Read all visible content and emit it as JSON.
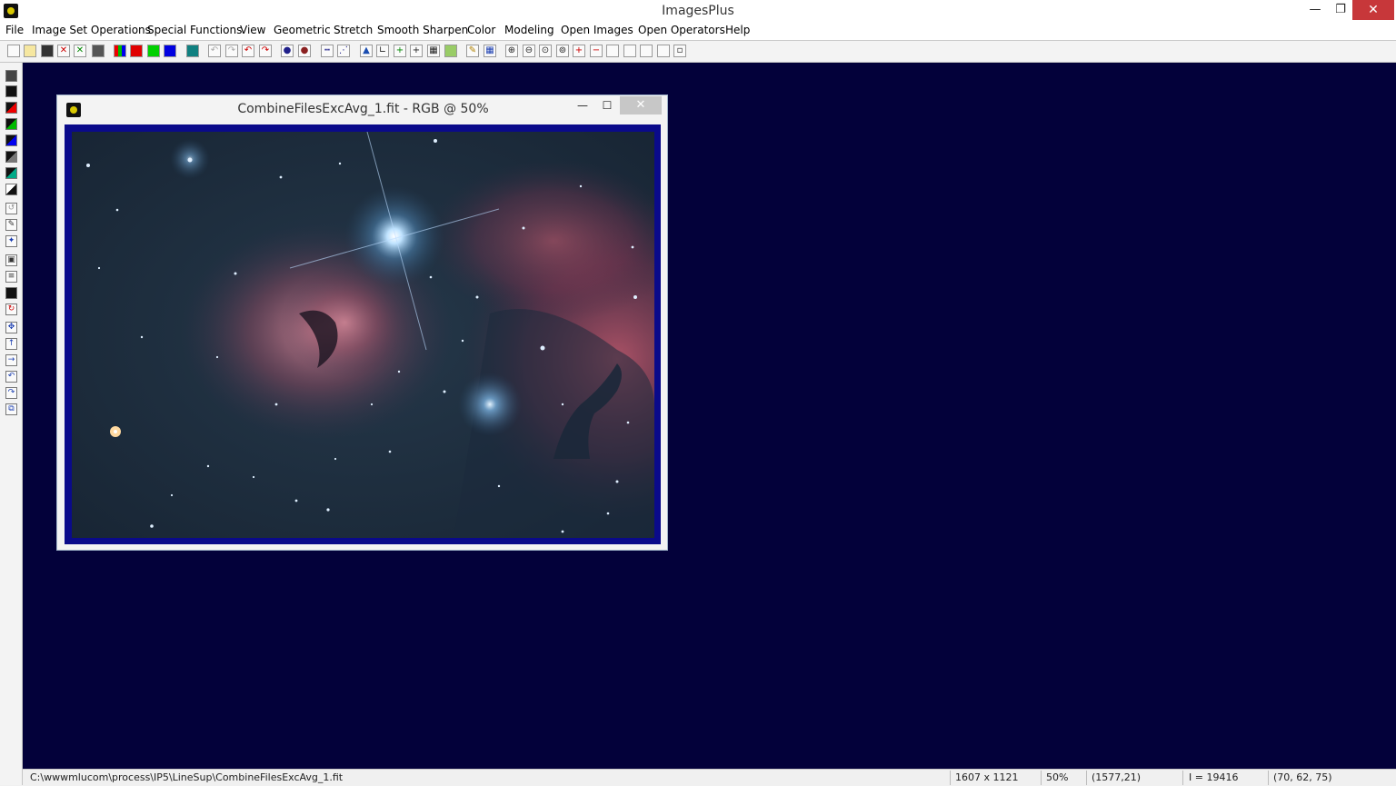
{
  "app": {
    "title": "ImagesPlus"
  },
  "window_controls": {
    "minimize": "—",
    "maximize": "❐",
    "close": "✕"
  },
  "menu": {
    "items": [
      "File",
      "Image Set Operations",
      "Special Functions",
      "View",
      "Geometric",
      "Stretch",
      "Smooth Sharpen",
      "Color",
      "Modeling",
      "Open Images",
      "Open Operators",
      "Help"
    ]
  },
  "toolbar": {
    "icons": [
      "new-file-icon",
      "open-file-icon",
      "save-icon",
      "close-x-red-icon",
      "close-x-green-icon",
      "print-icon",
      "rgb-channels-icon",
      "red-channel-icon",
      "green-channel-icon",
      "blue-channel-icon",
      "display-icon",
      "undo-disabled-icon",
      "redo-disabled-icon",
      "undo-icon",
      "redo-icon",
      "circle-select-icon",
      "ellipse-select-icon",
      "line-dots-icon",
      "plot-icon",
      "triangle-icon",
      "angle-icon",
      "crosshair-green-icon",
      "crosshair-icon",
      "grid-icon",
      "image-icon",
      "pencil-icon",
      "table-icon",
      "zoom-in-icon",
      "zoom-out-icon",
      "zoom-fit-icon",
      "zoom-actual-icon",
      "add-frame-icon",
      "remove-frame-icon",
      "frame-1-icon",
      "frame-2-icon",
      "frame-3-icon",
      "frame-4-icon",
      "frame-5-icon"
    ]
  },
  "left_toolbar": {
    "icons": [
      "save-small-icon",
      "black-square-icon",
      "red-channel-small-icon",
      "green-channel-small-icon",
      "blue-channel-small-icon",
      "mono-channel-icon",
      "mono-channel-2-icon",
      "invert-icon",
      "rotate-gray-icon",
      "edit-icon",
      "star-icon",
      "crop-icon",
      "align-icon",
      "rectangle-icon",
      "rotate-red-icon",
      "move-icon",
      "up-arrow-icon",
      "right-arrow-icon",
      "undo-small-icon",
      "redo-small-icon",
      "copy-icon"
    ]
  },
  "child_window": {
    "title": "CombineFilesExcAvg_1.fit - RGB @ 50%",
    "minimize": "—",
    "maximize": "☐",
    "close": "✕"
  },
  "status": {
    "path": "C:\\wwwmlucom\\process\\IP5\\LineSup\\CombineFilesExcAvg_1.fit",
    "dimensions": "1607 x 1121",
    "zoom": "50%",
    "cursor": "(1577,21)",
    "intensity": "I = 19416",
    "rgb": "(70, 62, 75)"
  },
  "colors": {
    "workspace": "#03013a",
    "image_frame": "#0a0a8a",
    "close_button": "#c7373a",
    "nebula_red": "#a8506a",
    "sky": "#1c2d3e"
  }
}
